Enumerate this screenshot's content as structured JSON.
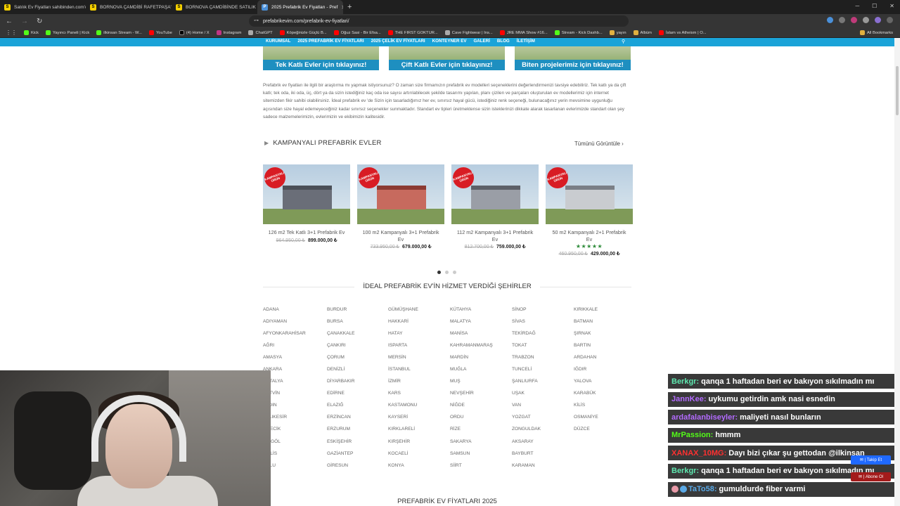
{
  "browser": {
    "tabs": [
      {
        "label": "Satılık Ev Fiyatları sahibinden.com'da",
        "fav": "S",
        "active": false
      },
      {
        "label": "BORNOVA ÇAMDİBİ RAFETPAŞA'DA",
        "fav": "S",
        "active": false
      },
      {
        "label": "BORNOVA ÇAMDİBİNDE SATILIK Mİ",
        "fav": "S",
        "active": false
      },
      {
        "label": "2025 Prefabrik Ev Fiyatları - Pref",
        "fav": "P",
        "active": true
      }
    ],
    "url": "prefabrikevim.com/prefabrik-ev-fiyatlari/",
    "bookmarks": [
      {
        "label": "Kick",
        "kind": "kick"
      },
      {
        "label": "Yayıncı Paneli | Kick",
        "kind": "kick"
      },
      {
        "label": "ilkinsan Stream - W...",
        "kind": "kick"
      },
      {
        "label": "YouTube",
        "kind": "yt"
      },
      {
        "label": "(4) Home / X",
        "kind": "x"
      },
      {
        "label": "Instagram",
        "kind": "ig"
      },
      {
        "label": "ChatGPT",
        "kind": "gpt"
      },
      {
        "label": "Köpeğinizle Güçlü B...",
        "kind": "yt"
      },
      {
        "label": "Oğuz Sasi - Bir Efsa...",
        "kind": "yt"
      },
      {
        "label": "THE FIRST GOKTUR...",
        "kind": "yt"
      },
      {
        "label": "Cave Fightwear | Ins...",
        "kind": "gpt"
      },
      {
        "label": "JRE MMA Show #16...",
        "kind": "yt"
      },
      {
        "label": "Stream - Kick Dashb...",
        "kind": "kick"
      },
      {
        "label": "yayın",
        "kind": "folder"
      },
      {
        "label": "Albüm",
        "kind": "folder"
      },
      {
        "label": "İslam vs Atheism | O...",
        "kind": "yt"
      }
    ],
    "all_bookmarks": "All Bookmarks"
  },
  "site": {
    "nav": [
      "KURUMSAL",
      "2025 PREFABRİK EV FİYATLARI",
      "2025 ÇELİK EV FİYATLARI",
      "KONTEYNER EV",
      "GALERİ",
      "BLOG",
      "İLETİŞİM"
    ],
    "banners": [
      "Tek Katlı Evler için tıklayınız!",
      "Çift Katlı Evler için tıklayınız!",
      "Biten projelerimiz için tıklayınız!"
    ],
    "intro": "Prefabrik ev fiyatları ile ilgili bir araştırma mı yapmak istiyorsunuz? O zaman size firmamızın prefabrik ev modelleri seçeneklerini değerlendirmenizi tavsiye edebiliriz. Tek katlı ya da çift katlı; tek oda, iki oda, üç, dört ya da sizin istediğiniz kaç oda ise sayısı artırılabilecek şekilde tasarımı yapılan, planı çizilen ve parçaları oluşturulan ev modellerimiz için internet sitemizden fikir sahibi olabilirsiniz. İdeal prefabrik ev 'de Sizin için tasarladığımız her ev, sınırsız hayal gücü, istediğiniz renk seçeneği, bulunacağınız yerin mevsimine uygunluğu açısından size hayal edemeyeceğiniz kadar sınırsız seçenekler sunmaktadır. Standart ev tipleri üretmektense sizin isteklerinizi dikkate alarak tasarlanan evlerimizde standart olan şey sadece malzemelerimizin, evlerimizin ve ekibimizin kalitesidir.",
    "campaign_heading": "KAMPANYALI PREFABRİK EVLER",
    "view_all": "Tümünü Görüntüle",
    "badge": "KAMPANYALI ÜRÜN",
    "products": [
      {
        "name": "126 m2 Tek Katlı 3+1 Prefabrik Ev",
        "old": "964.950,00 ₺",
        "new": "899.000,00 ₺",
        "stars": "",
        "roof": "#4b4f57",
        "wall": "#6a6e78"
      },
      {
        "name": "100 m2 Kampanyalı 3+1 Prefabrik Ev",
        "old": "733.950,00 ₺",
        "new": "679.000,00 ₺",
        "stars": "",
        "roof": "#8c3a32",
        "wall": "#c76a5e"
      },
      {
        "name": "112 m2 Kampanyalı 3+1 Prefabrik Ev",
        "old": "812.700,00 ₺",
        "new": "759.000,00 ₺",
        "stars": "",
        "roof": "#5d6068",
        "wall": "#9a9ea6"
      },
      {
        "name": "50 m2 Kampanyalı 2+1 Prefabrik Ev",
        "old": "460.950,00 ₺",
        "new": "429.000,00 ₺",
        "stars": "★★★★★",
        "roof": "#7b7f86",
        "wall": "#c9ccd0"
      }
    ],
    "cities_heading": "İDEAL PREFABRİK EV'İN HİZMET VERDİĞİ ŞEHİRLER",
    "city_columns": [
      [
        "ADANA",
        "ADIYAMAN",
        "AFYONKARAHİSAR",
        "AĞRI",
        "AMASYA",
        "ANKARA",
        "ANTALYA",
        "ARTVİN",
        "AYDIN",
        "BALIKESİR",
        "BİLECİK",
        "BİNGÖL",
        "BİTLİS",
        "BOLU"
      ],
      [
        "BURDUR",
        "BURSA",
        "ÇANAKKALE",
        "ÇANKIRI",
        "ÇORUM",
        "DENİZLİ",
        "DİYARBAKIR",
        "EDİRNE",
        "ELAZIĞ",
        "ERZİNCAN",
        "ERZURUM",
        "ESKİŞEHİR",
        "GAZİANTEP",
        "GİRESUN"
      ],
      [
        "GÜMÜŞHANE",
        "HAKKARİ",
        "HATAY",
        "ISPARTA",
        "MERSİN",
        "İSTANBUL",
        "İZMİR",
        "KARS",
        "KASTAMONU",
        "KAYSERİ",
        "KIRKLARELİ",
        "KIRŞEHİR",
        "KOCAELİ",
        "KONYA"
      ],
      [
        "KÜTAHYA",
        "MALATYA",
        "MANİSA",
        "KAHRAMANMARAŞ",
        "MARDİN",
        "MUĞLA",
        "MUŞ",
        "NEVŞEHİR",
        "NİĞDE",
        "ORDU",
        "RİZE",
        "SAKARYA",
        "SAMSUN",
        "SİİRT"
      ],
      [
        "SİNOP",
        "SİVAS",
        "TEKİRDAĞ",
        "TOKAT",
        "TRABZON",
        "TUNCELİ",
        "ŞANLIURFA",
        "UŞAK",
        "VAN",
        "YOZGAT",
        "ZONGULDAK",
        "AKSARAY",
        "BAYBURT",
        "KARAMAN"
      ],
      [
        "KIRIKKALE",
        "BATMAN",
        "ŞIRNAK",
        "BARTIN",
        "ARDAHAN",
        "IĞDIR",
        "YALOVA",
        "KARABÜK",
        "KİLİS",
        "OSMANİYE",
        "DÜZCE"
      ]
    ],
    "bottom_heading": "PREFABRİK EV FİYATLARI 2025"
  },
  "chat": [
    {
      "user": "Berkgr:",
      "color": "#5ee8b0",
      "text": "qanqa 1 haftadan beri ev bakıyon sıkılmadın mı"
    },
    {
      "user": "JannKee:",
      "color": "#b36bff",
      "text": "uykumu getirdin amk nasi esnedin"
    },
    {
      "user": "ardafalanbiseyler:",
      "color": "#b36bff",
      "text": "maliyeti nasıl bunların"
    },
    {
      "user": "MrPassion:",
      "color": "#53fc18",
      "text": "hmmm"
    },
    {
      "user": "XANAX_10MG:",
      "color": "#ff3030",
      "text": "Dayı bizi çıkar şu gettodan @ilkinsan"
    },
    {
      "user": "Berkgr:",
      "color": "#5ee8b0",
      "text": "qanqa 1 haftadan beri ev bakıyon sıkılmadın mı"
    },
    {
      "user": "TaTo58:",
      "color": "#5aa9e6",
      "text": "gumuldurde fiber varmi",
      "emotes": true
    }
  ],
  "overlay": {
    "follow": "Takip Et",
    "subscribe": "Abone Ol"
  }
}
